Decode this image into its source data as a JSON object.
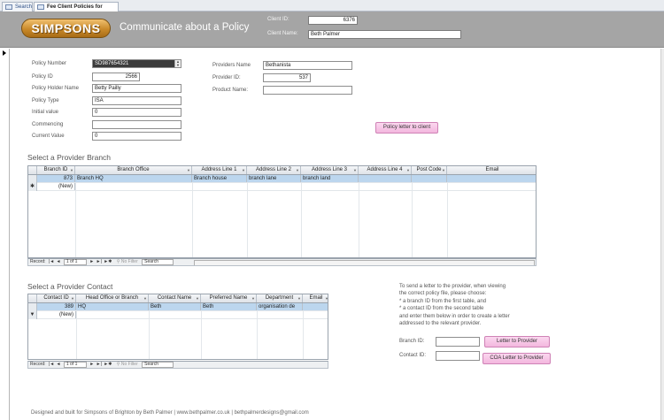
{
  "tabs": [
    {
      "label": "Search",
      "active": false
    },
    {
      "label": "Fee Client Policies for mailing",
      "active": true
    }
  ],
  "header": {
    "logo_text": "SIMPSONS",
    "title": "Communicate about a Policy",
    "client_id_label": "Client ID:",
    "client_id_value": "6376",
    "client_name_label": "Client Name:",
    "client_name_value": "Beth Palmer",
    "background": "#a5a5a5"
  },
  "policy": {
    "number_label": "Policy Number",
    "number_value": "SD987654321",
    "id_label": "Policy ID",
    "id_value": "2566",
    "holder_label": "Policy Holder Name",
    "holder_value": "Betty Pailly",
    "type_label": "Policy Type",
    "type_value": "ISA",
    "initial_label": "Initial value",
    "initial_value": "0",
    "commencing_label": "Commencing",
    "commencing_value": "",
    "current_label": "Current Value",
    "current_value": "0"
  },
  "provider": {
    "name_label": "Providers Name",
    "name_value": "Bethanista",
    "id_label": "Provider ID:",
    "id_value": "537",
    "product_label": "Product Name:",
    "product_value": ""
  },
  "buttons": {
    "policy_letter": "Policy letter to client",
    "letter_to_provider": "Letter to Provider",
    "coa_letter": "COA Letter to Provider",
    "accent": "#f3b6de"
  },
  "branch_section": {
    "title": "Select a Provider Branch",
    "columns": [
      "Branch ID",
      "Branch Office",
      "Address Line 1",
      "Address Line 2",
      "Address Line 3",
      "Address Line 4",
      "Post Code",
      "Email"
    ],
    "rows": [
      {
        "id": "873",
        "office": "Branch HQ",
        "addr1": "Branch house",
        "addr2": "branch lane",
        "addr3": "branch land",
        "addr4": "",
        "postcode": "",
        "email": ""
      }
    ],
    "new_label": "(New)",
    "nav": {
      "record_label": "Record:",
      "position": "1 of 1",
      "filter": "No Filter",
      "search": "Search"
    }
  },
  "contact_section": {
    "title": "Select a Provider Contact",
    "columns": [
      "Contact ID",
      "Head Office or Branch",
      "Contact Name",
      "Preferred Name",
      "Department",
      "Email"
    ],
    "rows": [
      {
        "id": "389",
        "office": "HQ",
        "name": "Beth",
        "preferred": "Beth",
        "department": "organisation de",
        "email": ""
      }
    ],
    "new_label": "(New)",
    "nav": {
      "record_label": "Record:",
      "position": "1 of 1",
      "filter": "No Filter",
      "search": "Search"
    }
  },
  "instructions": {
    "lines": [
      "To send a letter to the provider, when viewing",
      "the correct policy file, please choose:",
      "*  a branch ID from the first table, and",
      "*  a contact ID from the second table",
      "and enter them below in order to create a letter",
      "addressed to the relevant provider."
    ],
    "branch_id_label": "Branch ID:",
    "contact_id_label": "Contact ID:"
  },
  "footer": "Designed and built for Simpsons of Brighton by Beth Palmer  |  www.bethpalmer.co.uk  |  bethpalmerdesigns@gmail.com"
}
